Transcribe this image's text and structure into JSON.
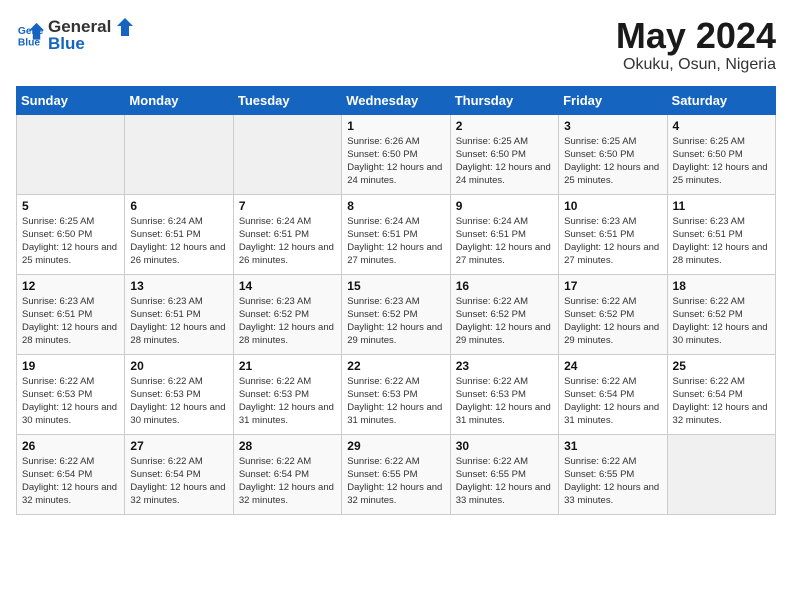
{
  "header": {
    "logo_line1": "General",
    "logo_line2": "Blue",
    "month_year": "May 2024",
    "location": "Okuku, Osun, Nigeria"
  },
  "days_of_week": [
    "Sunday",
    "Monday",
    "Tuesday",
    "Wednesday",
    "Thursday",
    "Friday",
    "Saturday"
  ],
  "weeks": [
    [
      {
        "day": "",
        "info": ""
      },
      {
        "day": "",
        "info": ""
      },
      {
        "day": "",
        "info": ""
      },
      {
        "day": "1",
        "info": "Sunrise: 6:26 AM\nSunset: 6:50 PM\nDaylight: 12 hours and 24 minutes."
      },
      {
        "day": "2",
        "info": "Sunrise: 6:25 AM\nSunset: 6:50 PM\nDaylight: 12 hours and 24 minutes."
      },
      {
        "day": "3",
        "info": "Sunrise: 6:25 AM\nSunset: 6:50 PM\nDaylight: 12 hours and 25 minutes."
      },
      {
        "day": "4",
        "info": "Sunrise: 6:25 AM\nSunset: 6:50 PM\nDaylight: 12 hours and 25 minutes."
      }
    ],
    [
      {
        "day": "5",
        "info": "Sunrise: 6:25 AM\nSunset: 6:50 PM\nDaylight: 12 hours and 25 minutes."
      },
      {
        "day": "6",
        "info": "Sunrise: 6:24 AM\nSunset: 6:51 PM\nDaylight: 12 hours and 26 minutes."
      },
      {
        "day": "7",
        "info": "Sunrise: 6:24 AM\nSunset: 6:51 PM\nDaylight: 12 hours and 26 minutes."
      },
      {
        "day": "8",
        "info": "Sunrise: 6:24 AM\nSunset: 6:51 PM\nDaylight: 12 hours and 27 minutes."
      },
      {
        "day": "9",
        "info": "Sunrise: 6:24 AM\nSunset: 6:51 PM\nDaylight: 12 hours and 27 minutes."
      },
      {
        "day": "10",
        "info": "Sunrise: 6:23 AM\nSunset: 6:51 PM\nDaylight: 12 hours and 27 minutes."
      },
      {
        "day": "11",
        "info": "Sunrise: 6:23 AM\nSunset: 6:51 PM\nDaylight: 12 hours and 28 minutes."
      }
    ],
    [
      {
        "day": "12",
        "info": "Sunrise: 6:23 AM\nSunset: 6:51 PM\nDaylight: 12 hours and 28 minutes."
      },
      {
        "day": "13",
        "info": "Sunrise: 6:23 AM\nSunset: 6:51 PM\nDaylight: 12 hours and 28 minutes."
      },
      {
        "day": "14",
        "info": "Sunrise: 6:23 AM\nSunset: 6:52 PM\nDaylight: 12 hours and 28 minutes."
      },
      {
        "day": "15",
        "info": "Sunrise: 6:23 AM\nSunset: 6:52 PM\nDaylight: 12 hours and 29 minutes."
      },
      {
        "day": "16",
        "info": "Sunrise: 6:22 AM\nSunset: 6:52 PM\nDaylight: 12 hours and 29 minutes."
      },
      {
        "day": "17",
        "info": "Sunrise: 6:22 AM\nSunset: 6:52 PM\nDaylight: 12 hours and 29 minutes."
      },
      {
        "day": "18",
        "info": "Sunrise: 6:22 AM\nSunset: 6:52 PM\nDaylight: 12 hours and 30 minutes."
      }
    ],
    [
      {
        "day": "19",
        "info": "Sunrise: 6:22 AM\nSunset: 6:53 PM\nDaylight: 12 hours and 30 minutes."
      },
      {
        "day": "20",
        "info": "Sunrise: 6:22 AM\nSunset: 6:53 PM\nDaylight: 12 hours and 30 minutes."
      },
      {
        "day": "21",
        "info": "Sunrise: 6:22 AM\nSunset: 6:53 PM\nDaylight: 12 hours and 31 minutes."
      },
      {
        "day": "22",
        "info": "Sunrise: 6:22 AM\nSunset: 6:53 PM\nDaylight: 12 hours and 31 minutes."
      },
      {
        "day": "23",
        "info": "Sunrise: 6:22 AM\nSunset: 6:53 PM\nDaylight: 12 hours and 31 minutes."
      },
      {
        "day": "24",
        "info": "Sunrise: 6:22 AM\nSunset: 6:54 PM\nDaylight: 12 hours and 31 minutes."
      },
      {
        "day": "25",
        "info": "Sunrise: 6:22 AM\nSunset: 6:54 PM\nDaylight: 12 hours and 32 minutes."
      }
    ],
    [
      {
        "day": "26",
        "info": "Sunrise: 6:22 AM\nSunset: 6:54 PM\nDaylight: 12 hours and 32 minutes."
      },
      {
        "day": "27",
        "info": "Sunrise: 6:22 AM\nSunset: 6:54 PM\nDaylight: 12 hours and 32 minutes."
      },
      {
        "day": "28",
        "info": "Sunrise: 6:22 AM\nSunset: 6:54 PM\nDaylight: 12 hours and 32 minutes."
      },
      {
        "day": "29",
        "info": "Sunrise: 6:22 AM\nSunset: 6:55 PM\nDaylight: 12 hours and 32 minutes."
      },
      {
        "day": "30",
        "info": "Sunrise: 6:22 AM\nSunset: 6:55 PM\nDaylight: 12 hours and 33 minutes."
      },
      {
        "day": "31",
        "info": "Sunrise: 6:22 AM\nSunset: 6:55 PM\nDaylight: 12 hours and 33 minutes."
      },
      {
        "day": "",
        "info": ""
      }
    ]
  ]
}
